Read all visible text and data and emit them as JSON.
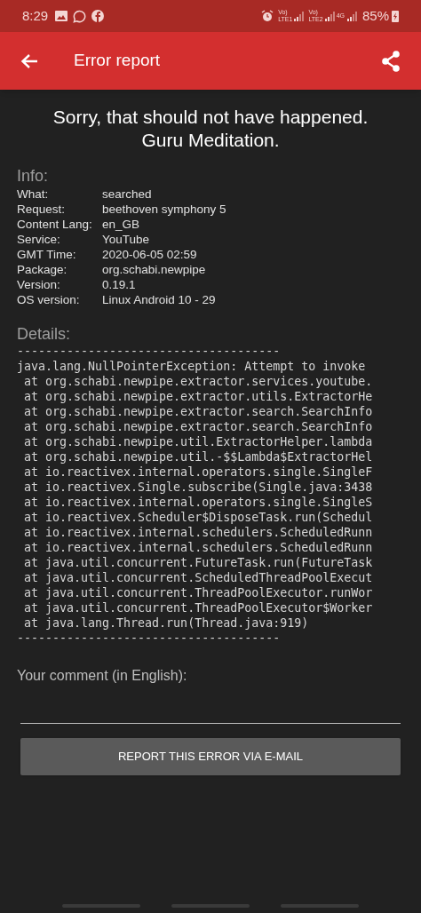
{
  "status_bar": {
    "time": "8:29",
    "sims": [
      {
        "top": "Vo)",
        "bottom": "LTE1"
      },
      {
        "top": "Vo)",
        "bottom": "LTE2"
      }
    ],
    "network": "4G",
    "battery": "85%"
  },
  "app_bar": {
    "title": "Error report"
  },
  "heading": [
    "Sorry, that should not have happened.",
    "Guru Meditation."
  ],
  "info": {
    "title": "Info:",
    "rows": [
      {
        "label": "What:",
        "value": "searched"
      },
      {
        "label": "Request:",
        "value": "beethoven symphony 5"
      },
      {
        "label": "Content Lang:",
        "value": "en_GB"
      },
      {
        "label": "Service:",
        "value": "YouTube"
      },
      {
        "label": "GMT Time:",
        "value": "2020-06-05 02:59"
      },
      {
        "label": "Package:",
        "value": "org.schabi.newpipe"
      },
      {
        "label": "Version:",
        "value": "0.19.1"
      },
      {
        "label": "OS version:",
        "value": "Linux Android 10 - 29"
      }
    ]
  },
  "details": {
    "title": "Details:",
    "lines": [
      "-------------------------------------",
      "java.lang.NullPointerException: Attempt to invoke",
      " at org.schabi.newpipe.extractor.services.youtube.",
      " at org.schabi.newpipe.extractor.utils.ExtractorHe",
      " at org.schabi.newpipe.extractor.search.SearchInfo",
      " at org.schabi.newpipe.extractor.search.SearchInfo",
      " at org.schabi.newpipe.util.ExtractorHelper.lambda",
      " at org.schabi.newpipe.util.-$$Lambda$ExtractorHel",
      " at io.reactivex.internal.operators.single.SingleF",
      " at io.reactivex.Single.subscribe(Single.java:3438",
      " at io.reactivex.internal.operators.single.SingleS",
      " at io.reactivex.Scheduler$DisposeTask.run(Schedul",
      " at io.reactivex.internal.schedulers.ScheduledRunn",
      " at io.reactivex.internal.schedulers.ScheduledRunn",
      " at java.util.concurrent.FutureTask.run(FutureTask",
      " at java.util.concurrent.ScheduledThreadPoolExecut",
      " at java.util.concurrent.ThreadPoolExecutor.runWor",
      " at java.util.concurrent.ThreadPoolExecutor$Worker",
      " at java.lang.Thread.run(Thread.java:919)",
      "-------------------------------------"
    ]
  },
  "comment": {
    "label": "Your comment (in English):"
  },
  "button": "REPORT THIS ERROR VIA E-MAIL"
}
